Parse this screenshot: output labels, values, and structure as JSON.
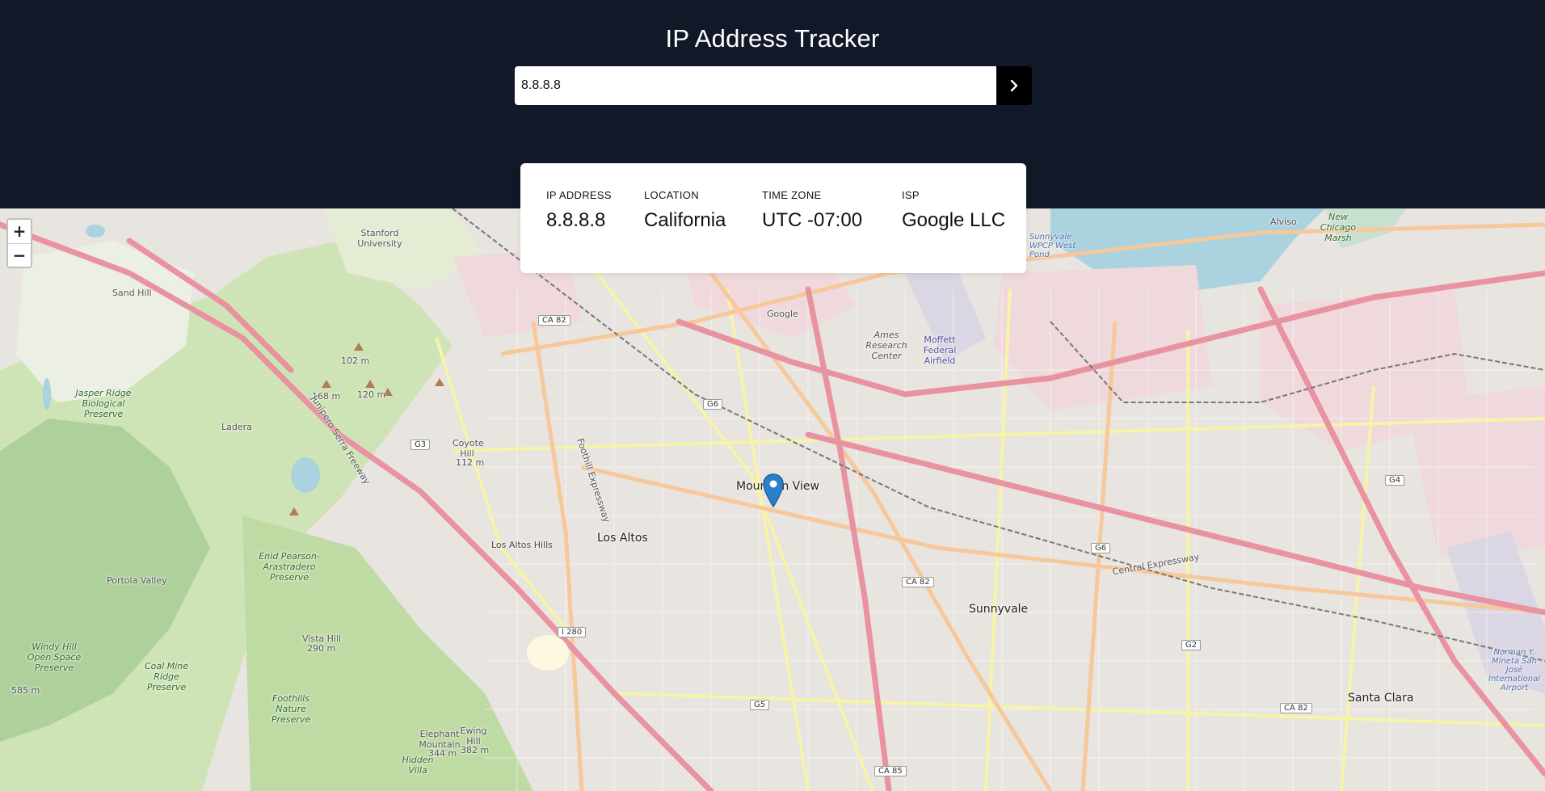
{
  "header": {
    "title": "IP Address Tracker",
    "search_value": "8.8.8.8",
    "search_button_icon": "chevron-right-icon"
  },
  "info": [
    {
      "label": "IP ADDRESS",
      "value": "8.8.8.8"
    },
    {
      "label": "LOCATION",
      "value": "California"
    },
    {
      "label": "TIME ZONE",
      "value": "UTC -07:00"
    },
    {
      "label": "ISP",
      "value": "Google LLC"
    }
  ],
  "map": {
    "zoom_in": "+",
    "zoom_out": "−",
    "marker_icon": "map-pin-icon",
    "labels": {
      "mountain_view": "Mountain View",
      "los_altos": "Los Altos",
      "los_altos_hills": "Los Altos Hills",
      "sunnyvale": "Sunnyvale",
      "santa_clara": "Santa Clara",
      "alviso": "Alviso",
      "stanford": "Stanford University",
      "ladera": "Ladera",
      "portola_valley": "Portola Valley",
      "sand_hill": "Sand Hill",
      "jasper_ridge": "Jasper Ridge Biological Preserve",
      "coyote_hill": "Coyote Hill",
      "coyote_hill_elev": "112 m",
      "google": "Google",
      "ames": "Ames Research Center",
      "moffett": "Moffett Federal Airfield",
      "enid_pearson": "Enid Pearson-Arastradero Preserve",
      "windy_hill": "Windy Hill Open Space Preserve",
      "coal_mine": "Coal Mine Ridge Preserve",
      "vista_hill": "Vista Hill",
      "vista_hill_elev": "290 m",
      "foothills": "Foothills Nature Preserve",
      "elephant_mountain": "Elephant Mountain",
      "elephant_elev": "344 m",
      "ewing_hill": "Ewing Hill",
      "ewing_elev": "382 m",
      "hidden_villa": "Hidden Villa",
      "new_chicago_marsh": "New Chicago Marsh",
      "sunnyvale_wpcp": "Sunnyvale WPCP West Pond",
      "norman_mineta": "Norman Y. Mineta San José International Airport",
      "elev_102": "102 m",
      "elev_168": "168 m",
      "elev_120": "120 m",
      "elev_585": "585 m",
      "central_expressway": "Central Expressway",
      "foothill_expressway": "Foothill Expressway",
      "junipero_serra": "Junipero Serra Freeway"
    },
    "shields": {
      "ca82a": "CA 82",
      "ca82b": "CA 82",
      "ca82c": "CA 82",
      "i280": "I 280",
      "ca85": "CA 85",
      "g6a": "G6",
      "g6b": "G6",
      "g3": "G3",
      "g5": "G5",
      "g2": "G2",
      "g4": "G4"
    }
  }
}
